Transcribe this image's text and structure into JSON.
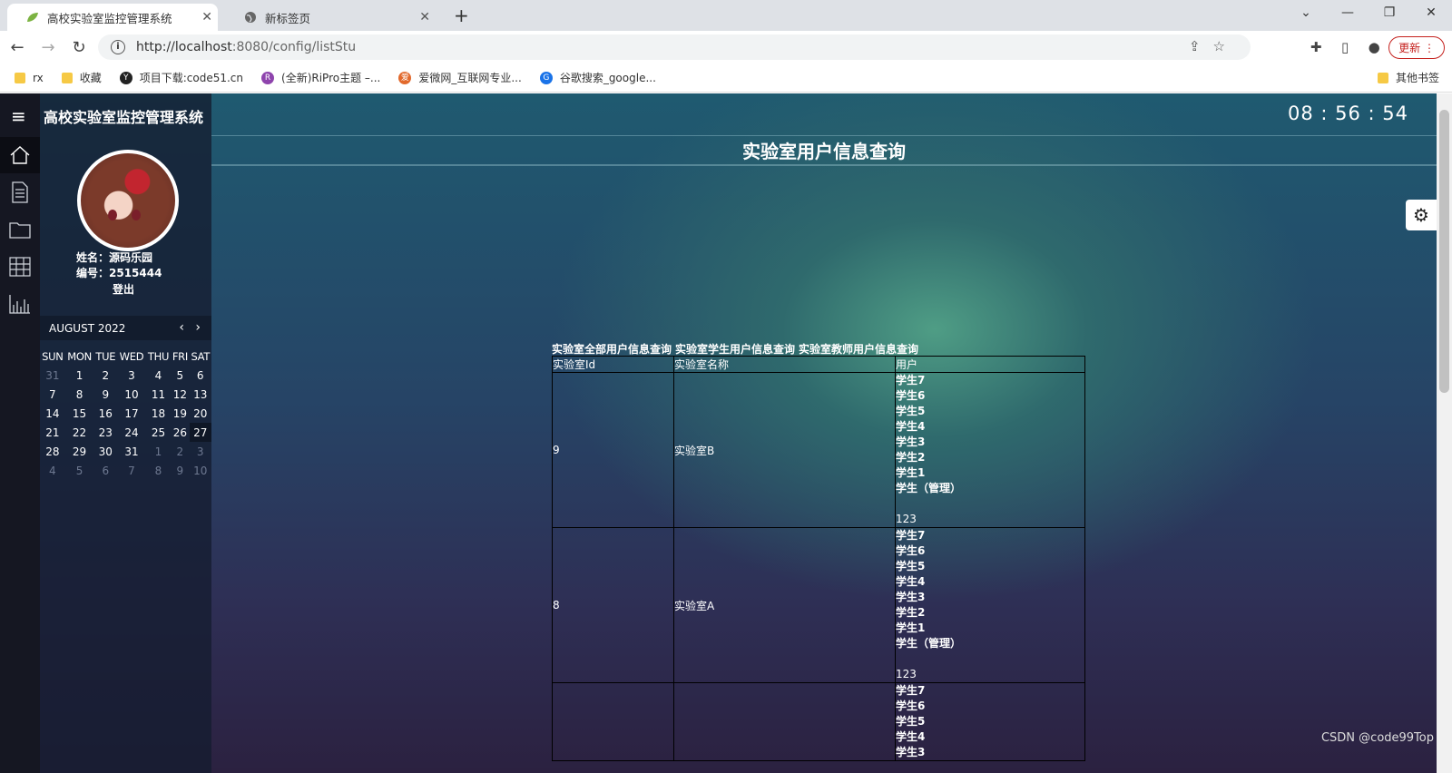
{
  "browser": {
    "tabs": [
      {
        "title": "高校实验室监控管理系统",
        "active": true
      },
      {
        "title": "新标签页",
        "active": false
      }
    ],
    "url_host": "http://localhost",
    "url_path": ":8080/config/listStu",
    "update_label": "更新",
    "bookmarks": [
      "rx",
      "收藏",
      "项目下载:code51.cn",
      "(全新)RiPro主题 –...",
      "爱微网_互联网专业...",
      "谷歌搜索_google..."
    ],
    "other_bookmarks": "其他书签"
  },
  "app": {
    "brand": "高校实验室监控管理系统",
    "user_name_line": "姓名：源码乐园",
    "user_id_line": "编号：2515444",
    "logout": "登出",
    "clock": "08 : 56 : 54",
    "page_title": "实验室用户信息查询",
    "watermark": "CSDN @code99Top"
  },
  "calendar": {
    "month": "AUGUST 2022",
    "weekdays": [
      "SUN",
      "MON",
      "TUE",
      "WED",
      "THU",
      "FRI",
      "SAT"
    ],
    "weeks": [
      [
        "31",
        "1",
        "2",
        "3",
        "4",
        "5",
        "6"
      ],
      [
        "7",
        "8",
        "9",
        "10",
        "11",
        "12",
        "13"
      ],
      [
        "14",
        "15",
        "16",
        "17",
        "18",
        "19",
        "20"
      ],
      [
        "21",
        "22",
        "23",
        "24",
        "25",
        "26",
        "27"
      ],
      [
        "28",
        "29",
        "30",
        "31",
        "1",
        "2",
        "3"
      ],
      [
        "4",
        "5",
        "6",
        "7",
        "8",
        "9",
        "10"
      ]
    ]
  },
  "query_links": [
    "实验室全部用户信息查询",
    "实验室学生用户信息查询",
    "实验室教师用户信息查询"
  ],
  "table": {
    "headers": [
      "实验室Id",
      "实验室名称",
      "用户"
    ],
    "rows": [
      {
        "id": "9",
        "name": "实验室B",
        "users": [
          "学生7",
          "学生6",
          "学生5",
          "学生4",
          "学生3",
          "学生2",
          "学生1",
          "学生（管理）",
          "",
          "123"
        ]
      },
      {
        "id": "8",
        "name": "实验室A",
        "users": [
          "学生7",
          "学生6",
          "学生5",
          "学生4",
          "学生3",
          "学生2",
          "学生1",
          "学生（管理）",
          "",
          "123"
        ]
      },
      {
        "id": "",
        "name": "",
        "users": [
          "学生7",
          "学生6",
          "学生5",
          "学生4",
          "学生3"
        ]
      }
    ]
  }
}
